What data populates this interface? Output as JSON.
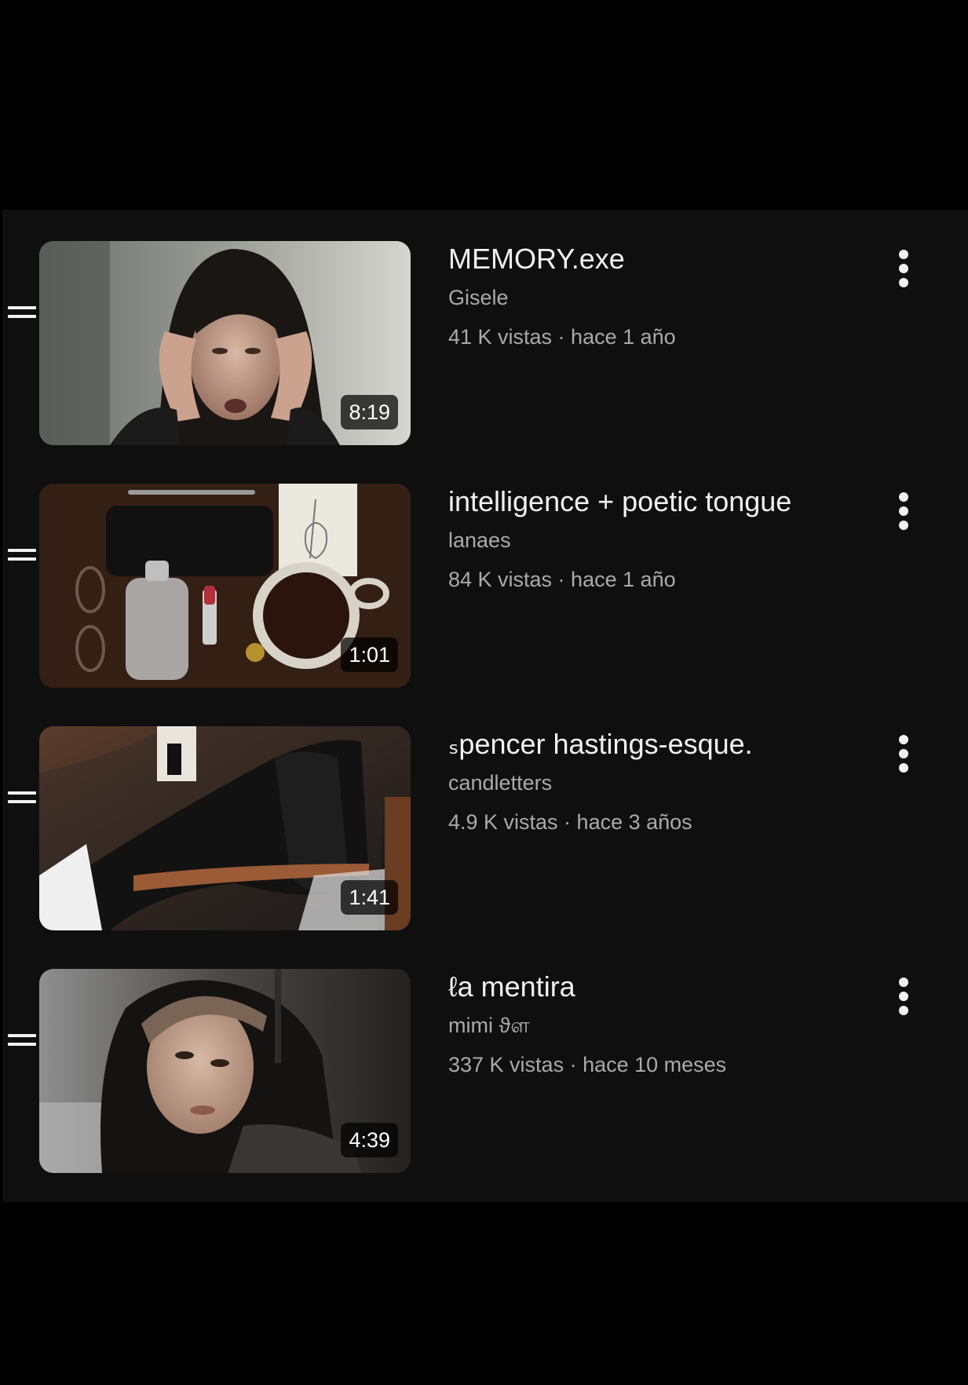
{
  "playlist": {
    "items": [
      {
        "title": "MEMORY.exe",
        "channel": "Gisele",
        "stats": "41 K vistas · hace 1 año",
        "duration": "8:19",
        "thumbnail_subject": "woman-holding-head"
      },
      {
        "title": "intelligence + poetic tongue",
        "channel": "lanaes",
        "stats": "84 K vistas · hace 1 año",
        "duration": "1:01",
        "thumbnail_subject": "desk-flatlay-coffee-perfume"
      },
      {
        "title": "ₛpencer hastings-esque.",
        "channel": "candletters",
        "stats": "4.9 K vistas · hace 3 años",
        "duration": "1:41",
        "thumbnail_subject": "black-leather-boots"
      },
      {
        "title": "ℓa mentira",
        "channel": "mimi ϑள",
        "stats": "337 K vistas · hace 10 meses",
        "duration": "4:39",
        "thumbnail_subject": "woman-with-headband"
      }
    ]
  },
  "icons": {
    "drag_handle": "drag-handle-icon",
    "more": "more-vertical-icon"
  },
  "colors": {
    "background": "#000000",
    "panel": "#0f0f0f",
    "title_text": "#f1f1f1",
    "secondary_text": "#aaaaaa"
  }
}
